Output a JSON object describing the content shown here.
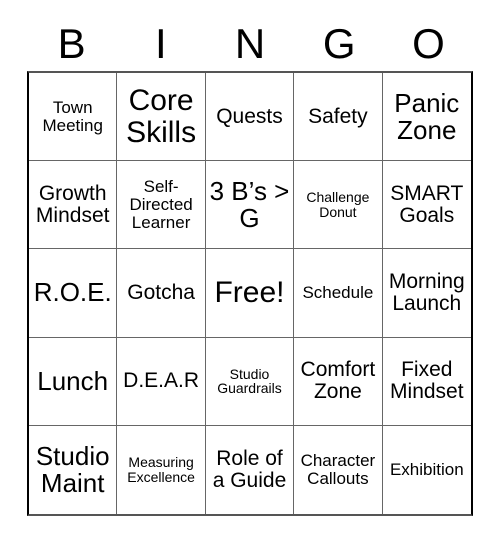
{
  "card": {
    "title": "BINGO",
    "headers": [
      "B",
      "I",
      "N",
      "G",
      "O"
    ],
    "rows": [
      [
        {
          "text": "Town Meeting",
          "size": "sm"
        },
        {
          "text": "Core Skills",
          "size": "xl"
        },
        {
          "text": "Quests",
          "size": "md"
        },
        {
          "text": "Safety",
          "size": "md"
        },
        {
          "text": "Panic Zone",
          "size": "lg"
        }
      ],
      [
        {
          "text": "Growth Mindset",
          "size": "md"
        },
        {
          "text": "Self-Directed Learner",
          "size": "sm"
        },
        {
          "text": "3 B’s > G",
          "size": "lg"
        },
        {
          "text": "Challenge Donut",
          "size": "xs"
        },
        {
          "text": "SMART Goals",
          "size": "md"
        }
      ],
      [
        {
          "text": "R.O.E.",
          "size": "lg"
        },
        {
          "text": "Gotcha",
          "size": "md"
        },
        {
          "text": "Free!",
          "size": "xl"
        },
        {
          "text": "Schedule",
          "size": "sm"
        },
        {
          "text": "Morning Launch",
          "size": "md"
        }
      ],
      [
        {
          "text": "Lunch",
          "size": "lg"
        },
        {
          "text": "D.E.A.R",
          "size": "md"
        },
        {
          "text": "Studio Guardrails",
          "size": "xs"
        },
        {
          "text": "Comfort Zone",
          "size": "md"
        },
        {
          "text": "Fixed Mindset",
          "size": "md"
        }
      ],
      [
        {
          "text": "Studio Maint",
          "size": "lg"
        },
        {
          "text": "Measuring Excellence",
          "size": "xs"
        },
        {
          "text": "Role of a Guide",
          "size": "md"
        },
        {
          "text": "Character Callouts",
          "size": "sm"
        },
        {
          "text": "Exhibition",
          "size": "sm"
        }
      ]
    ]
  },
  "colors": {
    "background": "#ffffff",
    "text": "#000000",
    "grid_line": "#666666",
    "grid_border": "#000000"
  }
}
